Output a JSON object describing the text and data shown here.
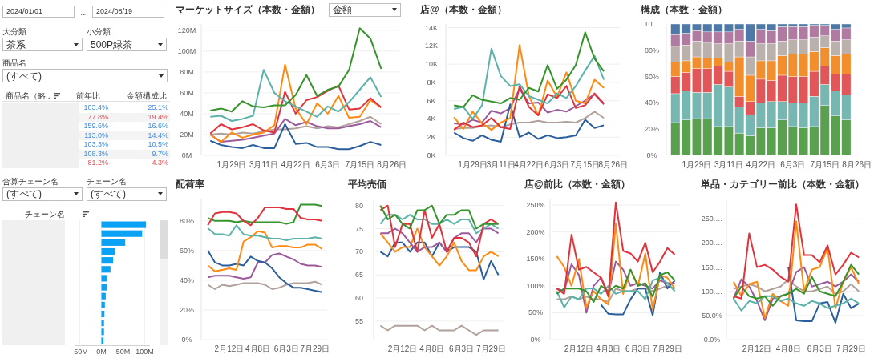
{
  "date_range": {
    "from": "2024/01/01",
    "separator": "～",
    "to": "2024/08/19"
  },
  "category_filters": [
    {
      "label": "大分類",
      "value": "茶系"
    },
    {
      "label": "小分類",
      "value": "500P緑茶"
    }
  ],
  "product_filter": {
    "label": "商品名",
    "value": "(すべて)"
  },
  "product_table": {
    "columns": [
      "商品名（略..",
      "前年比",
      "金額構成比"
    ],
    "rows": [
      {
        "yoy": "103.4%",
        "share": "25.1%",
        "kind": "increase"
      },
      {
        "yoy": "77.8%",
        "share": "19.4%",
        "kind": "decrease"
      },
      {
        "yoy": "159.6%",
        "share": "16.6%",
        "kind": "increase"
      },
      {
        "yoy": "113.0%",
        "share": "14.4%",
        "kind": "increase"
      },
      {
        "yoy": "103.3%",
        "share": "10.5%",
        "kind": "increase"
      },
      {
        "yoy": "108.3%",
        "share": "9.7%",
        "kind": "increase"
      },
      {
        "yoy": "81.2%",
        "share": "4.3%",
        "kind": "decrease"
      }
    ]
  },
  "chain_filters": [
    {
      "label": "合算チェーン名",
      "value": "(すべて)"
    },
    {
      "label": "チェーン名",
      "value": "(すべて)"
    }
  ],
  "chain_chart": {
    "column": "チェーン名",
    "chart_data": {
      "type": "bar",
      "orientation": "horizontal",
      "grid": true,
      "xlim": [
        -62,
        112
      ],
      "xticks": [
        {
          "value": -50,
          "label": "-50M"
        },
        {
          "value": 0,
          "label": "0M"
        },
        {
          "value": 50,
          "label": "50M"
        },
        {
          "value": 100,
          "label": "100M"
        }
      ],
      "values": [
        103,
        94,
        55,
        32,
        27,
        21,
        13,
        12,
        10,
        8,
        7,
        6,
        6,
        5
      ]
    }
  },
  "charts": [
    {
      "title": "マーケットサイズ（本数・金額）",
      "dropdown": "金額",
      "chart_data": {
        "type": "line",
        "grid": true,
        "ylim": [
          0,
          126
        ],
        "categories": [
          null,
          null,
          "1月29日",
          null,
          null,
          "3月11日",
          null,
          null,
          "4月22日",
          null,
          null,
          "6月3日",
          null,
          null,
          "7月15日",
          null,
          null,
          "8月26日"
        ],
        "yticks": [
          {
            "value": 0,
            "label": "0M"
          },
          {
            "value": 20,
            "label": "20M"
          },
          {
            "value": 40,
            "label": "40M"
          },
          {
            "value": 60,
            "label": "60M"
          },
          {
            "value": 80,
            "label": "80M"
          },
          {
            "value": 100,
            "label": "100M"
          },
          {
            "value": 120,
            "label": "120M"
          }
        ],
        "series": [
          {
            "color": "#b0a19b",
            "values": [
              20,
              21,
              20,
              22,
              21,
              23,
              25,
              25,
              26,
              28,
              26,
              28,
              27,
              30,
              33,
              37,
              30,
              null
            ]
          },
          {
            "color": "#9c5a9c",
            "values": [
              20,
              13,
              14,
              15,
              17,
              19,
              21,
              35,
              29,
              32,
              28,
              26,
              26,
              28,
              30,
              33,
              27,
              null
            ]
          },
          {
            "color": "#2a5e9c",
            "values": [
              14,
              10,
              8,
              7,
              10,
              7,
              7,
              30,
              11,
              12,
              8,
              8,
              6,
              6,
              9,
              13,
              10,
              null
            ]
          },
          {
            "color": "#ff8a0f",
            "values": [
              20,
              13,
              22,
              17,
              20,
              22,
              29,
              87,
              45,
              30,
              50,
              40,
              57,
              36,
              37,
              53,
              46,
              null
            ]
          },
          {
            "color": "#e2323b",
            "values": [
              21,
              30,
              25,
              27,
              30,
              24,
              22,
              61,
              40,
              53,
              56,
              62,
              67,
              44,
              45,
              55,
              46,
              null
            ]
          },
          {
            "color": "#5bb2aa",
            "values": [
              37,
              38,
              33,
              35,
              38,
              82,
              60,
              52,
              47,
              42,
              37,
              47,
              42,
              51,
              63,
              75,
              56,
              null
            ]
          },
          {
            "color": "#35952b",
            "values": [
              43,
              45,
              42,
              52,
              47,
              46,
              48,
              48,
              58,
              77,
              57,
              63,
              66,
              82,
              122,
              112,
              83,
              null
            ]
          }
        ]
      }
    },
    {
      "title": "店@（本数・金額）",
      "chart_data": {
        "type": "line",
        "grid": true,
        "ylim": [
          0,
          14.4
        ],
        "categories": [
          null,
          null,
          "1月29日",
          null,
          null,
          "3月11日",
          null,
          null,
          "4月22日",
          null,
          null,
          "6月3日",
          null,
          null,
          "7月15日",
          null,
          null,
          "8月26日"
        ],
        "yticks": [
          {
            "value": 0,
            "label": "0K"
          },
          {
            "value": 2,
            "label": "2K"
          },
          {
            "value": 4,
            "label": "4K"
          },
          {
            "value": 6,
            "label": "6K"
          },
          {
            "value": 8,
            "label": "8K"
          },
          {
            "value": 10,
            "label": "10K"
          },
          {
            "value": 12,
            "label": "12K"
          },
          {
            "value": 14,
            "label": "14K"
          }
        ],
        "series": [
          {
            "color": "#b0a19b",
            "values": [
              2.9,
              3.0,
              3.0,
              3.2,
              3.3,
              3.1,
              3.4,
              3.6,
              3.6,
              3.8,
              3.6,
              3.6,
              3.7,
              3.6,
              4.1,
              4.8,
              4.1,
              null
            ]
          },
          {
            "color": "#9c5a9c",
            "values": [
              3.5,
              3.4,
              3.9,
              3.6,
              4.9,
              4.6,
              5.2,
              7.3,
              5.7,
              5.8,
              4.7,
              5.0,
              4.8,
              5.4,
              6.0,
              6.7,
              5.6,
              null
            ]
          },
          {
            "color": "#2a5e9c",
            "values": [
              2.5,
              1.9,
              1.6,
              2.2,
              1.7,
              1.5,
              5.6,
              2.0,
              2.5,
              1.8,
              2.2,
              1.9,
              2.0,
              2.2,
              3.9,
              3.0,
              3.3,
              null
            ]
          },
          {
            "color": "#ff8a0f",
            "values": [
              4.2,
              2.9,
              4.8,
              3.5,
              2.8,
              3.6,
              4.1,
              12.1,
              6.5,
              4.4,
              8.2,
              6.4,
              9.1,
              6.0,
              5.7,
              8.3,
              7.4,
              null
            ]
          },
          {
            "color": "#e2323b",
            "values": [
              2.8,
              3.6,
              3.1,
              3.3,
              4.1,
              3.1,
              2.9,
              7.6,
              5.3,
              4.4,
              6.7,
              6.3,
              7.6,
              5.2,
              5.5,
              6.8,
              5.7,
              null
            ]
          },
          {
            "color": "#5bb2aa",
            "values": [
              5.1,
              5.3,
              4.0,
              5.5,
              11.7,
              8.7,
              7.6,
              7.8,
              6.5,
              6.1,
              5.7,
              6.8,
              6.3,
              7.6,
              9.3,
              10.9,
              8.3,
              null
            ]
          },
          {
            "color": "#35952b",
            "values": [
              5.5,
              5.3,
              6.6,
              6.1,
              5.9,
              5.7,
              6.3,
              6.1,
              7.4,
              7.0,
              9.9,
              7.3,
              8.3,
              9.9,
              13.5,
              10.6,
              9.2,
              null
            ]
          }
        ]
      }
    },
    {
      "title": "構成（本数・金額）",
      "chart_data": {
        "type": "bar",
        "stacked": true,
        "ylim": [
          0,
          1
        ],
        "categories": [
          null,
          null,
          "1月29日",
          null,
          null,
          "3月11日",
          null,
          null,
          "4月22日",
          null,
          null,
          "6月3日",
          null,
          null,
          "7月15日",
          null,
          null,
          "8月26日"
        ],
        "yticks": [
          {
            "value": 0,
            "label": "0%"
          },
          {
            "value": 0.2,
            "label": "20%"
          },
          {
            "value": 0.4,
            "label": "40%"
          },
          {
            "value": 0.6,
            "label": "60%"
          },
          {
            "value": 0.8,
            "label": "80%"
          },
          {
            "value": 1,
            "label": "10…"
          }
        ],
        "series": [
          {
            "color": "#59a14f",
            "values": [
              0.25,
              0.27,
              0.28,
              0.28,
              0.22,
              0.22,
              0.17,
              0.15,
              0.21,
              0.21,
              0.27,
              0.22,
              0.21,
              0.22,
              0.38,
              0.3,
              0.27,
              null
            ]
          },
          {
            "color": "#76b7b2",
            "values": [
              0.22,
              0.22,
              0.2,
              0.2,
              0.32,
              0.3,
              0.2,
              0.16,
              0.19,
              0.2,
              0.14,
              0.18,
              0.19,
              0.23,
              0.16,
              0.19,
              0.19,
              null
            ]
          },
          {
            "color": "#e15759",
            "values": [
              0.13,
              0.14,
              0.18,
              0.18,
              0.14,
              0.12,
              0.08,
              0.1,
              0.18,
              0.16,
              0.2,
              0.2,
              0.2,
              0.19,
              0.14,
              0.13,
              0.16,
              null
            ]
          },
          {
            "color": "#f28e2b",
            "values": [
              0.11,
              0.09,
              0.09,
              0.08,
              0.06,
              0.07,
              0.3,
              0.2,
              0.14,
              0.15,
              0.15,
              0.17,
              0.17,
              0.15,
              0.14,
              0.14,
              0.15,
              null
            ]
          },
          {
            "color": "#bab0ac",
            "values": [
              0.12,
              0.12,
              0.12,
              0.12,
              0.11,
              0.14,
              0.12,
              0.14,
              0.13,
              0.13,
              0.11,
              0.11,
              0.11,
              0.11,
              0.09,
              0.11,
              0.11,
              null
            ]
          },
          {
            "color": "#b07aa1",
            "values": [
              0.09,
              0.09,
              0.08,
              0.08,
              0.09,
              0.09,
              0.09,
              0.12,
              0.11,
              0.1,
              0.11,
              0.1,
              0.1,
              0.09,
              0.08,
              0.09,
              0.09,
              null
            ]
          },
          {
            "color": "#4e79a7",
            "values": [
              0.08,
              0.07,
              0.05,
              0.06,
              0.06,
              0.06,
              0.04,
              0.13,
              0.04,
              0.05,
              0.02,
              0.02,
              0.02,
              0.01,
              0.01,
              0.04,
              0.03,
              null
            ]
          }
        ]
      }
    },
    {
      "title": "配荷率",
      "chart_data": {
        "type": "line",
        "grid": true,
        "ylim": [
          0,
          95
        ],
        "categories": [
          null,
          null,
          null,
          "2月12日",
          null,
          null,
          null,
          "4月8日",
          null,
          null,
          null,
          "6月3日",
          null,
          null,
          null,
          "7月29日",
          null
        ],
        "yticks": [
          {
            "value": 0,
            "label": "0%"
          },
          {
            "value": 20,
            "label": "20%"
          },
          {
            "value": 40,
            "label": "40%"
          },
          {
            "value": 60,
            "label": "60%"
          },
          {
            "value": 80,
            "label": "80%"
          }
        ],
        "series": [
          {
            "color": "#b0a19b",
            "values": [
              37,
              34,
              37,
              36,
              37,
              38,
              38,
              38,
              37,
              34,
              35,
              37,
              38,
              38,
              38,
              39,
              37
            ]
          },
          {
            "color": "#9c5a9c",
            "values": [
              42,
              43,
              43,
              43,
              42,
              41,
              42,
              52,
              52,
              57,
              58,
              56,
              54,
              51,
              50,
              50,
              49
            ]
          },
          {
            "color": "#2a5e9c",
            "values": [
              60,
              52,
              50,
              50,
              51,
              50,
              56,
              53,
              52,
              48,
              42,
              38,
              35,
              35,
              34,
              33,
              32
            ]
          },
          {
            "color": "#ff8a0f",
            "values": [
              50,
              46,
              47,
              48,
              47,
              66,
              69,
              73,
              72,
              62,
              63,
              63,
              62,
              62,
              64,
              64,
              61
            ]
          },
          {
            "color": "#5bb2aa",
            "values": [
              75,
              71,
              71,
              70,
              77,
              71,
              70,
              70,
              69,
              68,
              68,
              67,
              68,
              68,
              68,
              69,
              68
            ]
          },
          {
            "color": "#35952b",
            "values": [
              82,
              80,
              80,
              80,
              79,
              80,
              79,
              79,
              79,
              79,
              79,
              78,
              79,
              91,
              91,
              91,
              90
            ]
          },
          {
            "color": "#e2323b",
            "values": [
              77,
              85,
              86,
              86,
              85,
              80,
              77,
              82,
              89,
              89,
              89,
              88,
              88,
              82,
              81,
              81,
              80
            ]
          }
        ]
      }
    },
    {
      "title": "平均売価",
      "chart_data": {
        "type": "line",
        "grid": true,
        "ylim": [
          51,
          81.5
        ],
        "categories": [
          null,
          null,
          null,
          "2月12日",
          null,
          null,
          null,
          "4月8日",
          null,
          null,
          null,
          "6月3日",
          null,
          null,
          null,
          "7月29日",
          null
        ],
        "yticks": [
          {
            "value": 55,
            "label": "55"
          },
          {
            "value": 60,
            "label": "60"
          },
          {
            "value": 65,
            "label": "65"
          },
          {
            "value": 70,
            "label": "70"
          },
          {
            "value": 75,
            "label": "75"
          },
          {
            "value": 80,
            "label": "80"
          }
        ],
        "series": [
          {
            "color": "#b0a19b",
            "values": [
              54,
              53,
              54,
              54,
              54,
              54,
              53,
              54,
              53,
              53,
              53,
              54,
              53,
              52,
              53,
              53,
              53
            ]
          },
          {
            "color": "#2a5e9c",
            "values": [
              70,
              69,
              72,
              72,
              70,
              72,
              72,
              69,
              72,
              70,
              71,
              71,
              71,
              70,
              64,
              68,
              65
            ]
          },
          {
            "color": "#ff8a0f",
            "values": [
              74,
              72,
              70,
              71,
              71,
              75,
              71,
              69,
              67,
              69,
              72,
              68,
              66,
              66,
              69,
              70,
              69
            ]
          },
          {
            "color": "#9c5a9c",
            "values": [
              74,
              74,
              75,
              74,
              72,
              70,
              71,
              71,
              72,
              70,
              73,
              74,
              74,
              72,
              75,
              75,
              74
            ]
          },
          {
            "color": "#5bb2aa",
            "values": [
              76,
              78,
              78,
              77,
              78,
              77,
              77,
              76,
              76,
              77,
              76,
              77,
              77,
              74,
              75,
              76,
              75
            ]
          },
          {
            "color": "#e2323b",
            "values": [
              79,
              80,
              71,
              76,
              76,
              70,
              79,
              73,
              76,
              70,
              73,
              73,
              72,
              69,
              76,
              77,
              76
            ]
          },
          {
            "color": "#35952b",
            "values": [
              80,
              77,
              78,
              76,
              75,
              79,
              79,
              80,
              76,
              78,
              78,
              79,
              79,
              75,
              76,
              76,
              76
            ]
          }
        ]
      }
    },
    {
      "title": "店@前比（本数・金額）",
      "chart_data": {
        "type": "line",
        "grid": true,
        "ylim": [
          0,
          262
        ],
        "categories": [
          null,
          null,
          null,
          "2月12日",
          null,
          null,
          null,
          "4月8日",
          null,
          null,
          null,
          "6月3日",
          null,
          null,
          null,
          "7月29日",
          null
        ],
        "yticks": [
          {
            "value": 0,
            "label": "0%"
          },
          {
            "value": 50,
            "label": "50%"
          },
          {
            "value": 100,
            "label": "100%"
          },
          {
            "value": 150,
            "label": "150%"
          },
          {
            "value": 200,
            "label": "200%"
          },
          {
            "value": 250,
            "label": "250%"
          }
        ],
        "series": [
          {
            "color": "#b0a19b",
            "values": [
              75,
              75,
              80,
              75,
              80,
              75,
              75,
              70,
              95,
              90,
              90,
              95,
              95,
              90,
              95,
              100,
              95
            ]
          },
          {
            "color": "#2a5e9c",
            "values": [
              null,
              null,
              null,
              null,
              null,
              null,
              65,
              48,
              47,
              47,
              75,
              95,
              95,
              45,
              125,
              95,
              110
            ]
          },
          {
            "color": "#9c5a9c",
            "values": [
              95,
              90,
              140,
              120,
              50,
              100,
              115,
              85,
              145,
              130,
              100,
              105,
              100,
              95,
              110,
              105,
              105
            ]
          },
          {
            "color": "#ff8a0f",
            "values": [
              155,
              135,
              100,
              150,
              60,
              90,
              75,
              65,
              215,
              85,
              130,
              100,
              160,
              55,
              120,
              115,
              95
            ]
          },
          {
            "color": "#5bb2aa",
            "values": [
              90,
              60,
              80,
              75,
              95,
              95,
              85,
              100,
              85,
              90,
              90,
              90,
              75,
              110,
              115,
              105,
              90
            ]
          },
          {
            "color": "#35952b",
            "values": [
              85,
              95,
              95,
              95,
              90,
              70,
              100,
              90,
              100,
              95,
              130,
              100,
              105,
              80,
              120,
              125,
              110
            ]
          },
          {
            "color": "#e2323b",
            "values": [
              95,
              85,
              195,
              130,
              135,
              125,
              115,
              80,
              255,
              165,
              160,
              145,
              180,
              125,
              145,
              170,
              158
            ]
          }
        ]
      }
    },
    {
      "title": "単品・カテゴリー前比（本数・金額）",
      "chart_data": {
        "type": "line",
        "grid": true,
        "ylim": [
          0,
          292
        ],
        "categories": [
          null,
          null,
          null,
          "2月12日",
          null,
          null,
          null,
          "4月8日",
          null,
          null,
          null,
          "6月3日",
          null,
          null,
          null,
          "7月29日",
          null
        ],
        "yticks": [
          {
            "value": 0,
            "label": "0.0%"
          },
          {
            "value": 50,
            "label": "50.0%"
          },
          {
            "value": 100,
            "label": "100.…"
          },
          {
            "value": 150,
            "label": "150.…"
          },
          {
            "value": 200,
            "label": "200.…"
          },
          {
            "value": 250,
            "label": "250.…"
          }
        ],
        "series": [
          {
            "color": "#b0a19b",
            "values": [
              105,
              110,
              115,
              110,
              100,
              105,
              110,
              125,
              110,
              100,
              100,
              105,
              110,
              95,
              100,
              115,
              100
            ]
          },
          {
            "color": "#2a5e9c",
            "values": [
              null,
              null,
              null,
              null,
              null,
              null,
              null,
              150,
              40,
              38,
              38,
              75,
              78,
              35,
              95,
              65,
              75
            ]
          },
          {
            "color": "#9c5a9c",
            "values": [
              85,
              125,
              110,
              80,
              40,
              85,
              90,
              95,
              140,
              150,
              110,
              115,
              120,
              110,
              120,
              135,
              120
            ]
          },
          {
            "color": "#ff8a0f",
            "values": [
              120,
              90,
              115,
              120,
              45,
              95,
              80,
              70,
              245,
              100,
              145,
              150,
              190,
              65,
              120,
              150,
              115
            ]
          },
          {
            "color": "#5bb2aa",
            "values": [
              85,
              60,
              80,
              75,
              90,
              90,
              80,
              85,
              75,
              70,
              80,
              75,
              65,
              70,
              75,
              85,
              75
            ]
          },
          {
            "color": "#35952b",
            "values": [
              85,
              110,
              90,
              85,
              90,
              70,
              90,
              95,
              105,
              95,
              130,
              100,
              95,
              90,
              120,
              155,
              135
            ]
          },
          {
            "color": "#e2323b",
            "values": [
              90,
              85,
              220,
              150,
              155,
              145,
              130,
              120,
              280,
              175,
              175,
              160,
              195,
              135,
              155,
              180,
              170
            ]
          }
        ]
      }
    }
  ]
}
